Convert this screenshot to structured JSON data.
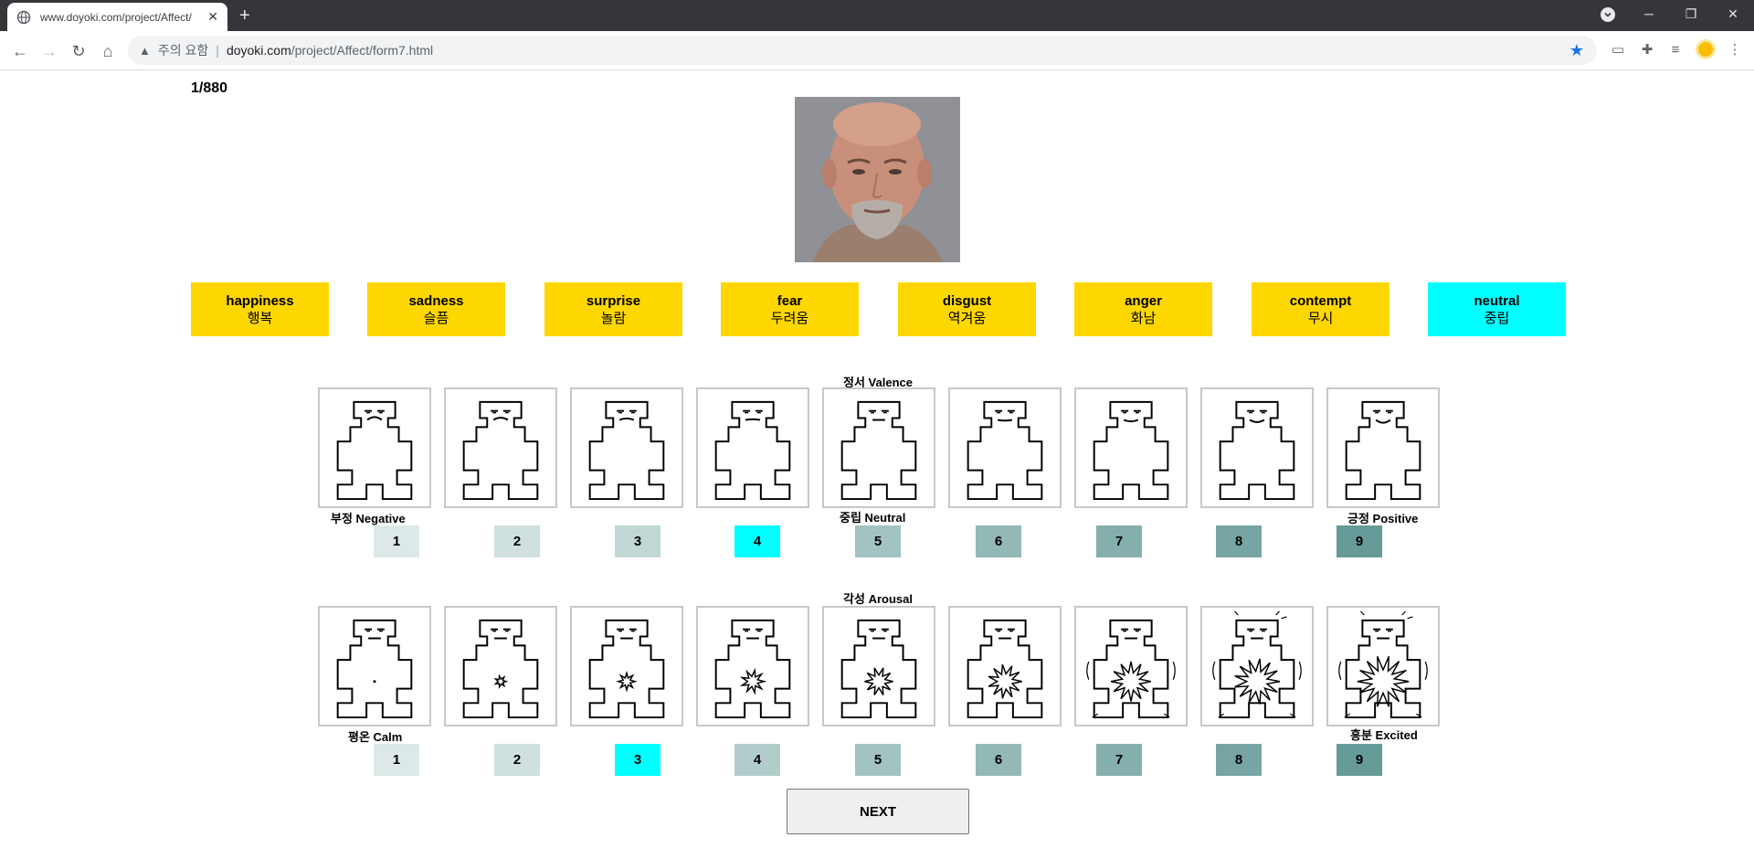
{
  "browser": {
    "tab_title": "www.doyoki.com/project/Affect/",
    "newtab_label": "+",
    "security_label": "주의 요함",
    "url_host": "doyoki.com",
    "url_path": "/project/Affect/form7.html"
  },
  "page": {
    "counter": "1/880",
    "next_label": "NEXT"
  },
  "emotions": [
    {
      "en": "happiness",
      "ko": "행복",
      "selected": false
    },
    {
      "en": "sadness",
      "ko": "슬픔",
      "selected": false
    },
    {
      "en": "surprise",
      "ko": "놀람",
      "selected": false
    },
    {
      "en": "fear",
      "ko": "두려움",
      "selected": false
    },
    {
      "en": "disgust",
      "ko": "역겨움",
      "selected": false
    },
    {
      "en": "anger",
      "ko": "화남",
      "selected": false
    },
    {
      "en": "contempt",
      "ko": "무시",
      "selected": false
    },
    {
      "en": "neutral",
      "ko": "중립",
      "selected": true
    }
  ],
  "valence": {
    "title": "정서 Valence",
    "anchor_low": "부정 Negative",
    "anchor_mid": "중립 Neutral",
    "anchor_high": "긍정 Positive",
    "numbers": [
      "1",
      "2",
      "3",
      "4",
      "5",
      "6",
      "7",
      "8",
      "9"
    ],
    "selected": 4
  },
  "arousal": {
    "title": "각성 Arousal",
    "anchor_low": "평온 Calm",
    "anchor_high": "흥분 Excited",
    "numbers": [
      "1",
      "2",
      "3",
      "4",
      "5",
      "6",
      "7",
      "8",
      "9"
    ],
    "selected": 3
  },
  "colors": {
    "emotion_button": "#ffd700",
    "selected": "#00ffff",
    "number_shades": [
      "#dde9e8",
      "#cfe0df",
      "#c0d7d5",
      "#b1cdcb",
      "#a2c3c1",
      "#93b9b7",
      "#85afad",
      "#76a5a3",
      "#679b99"
    ]
  }
}
